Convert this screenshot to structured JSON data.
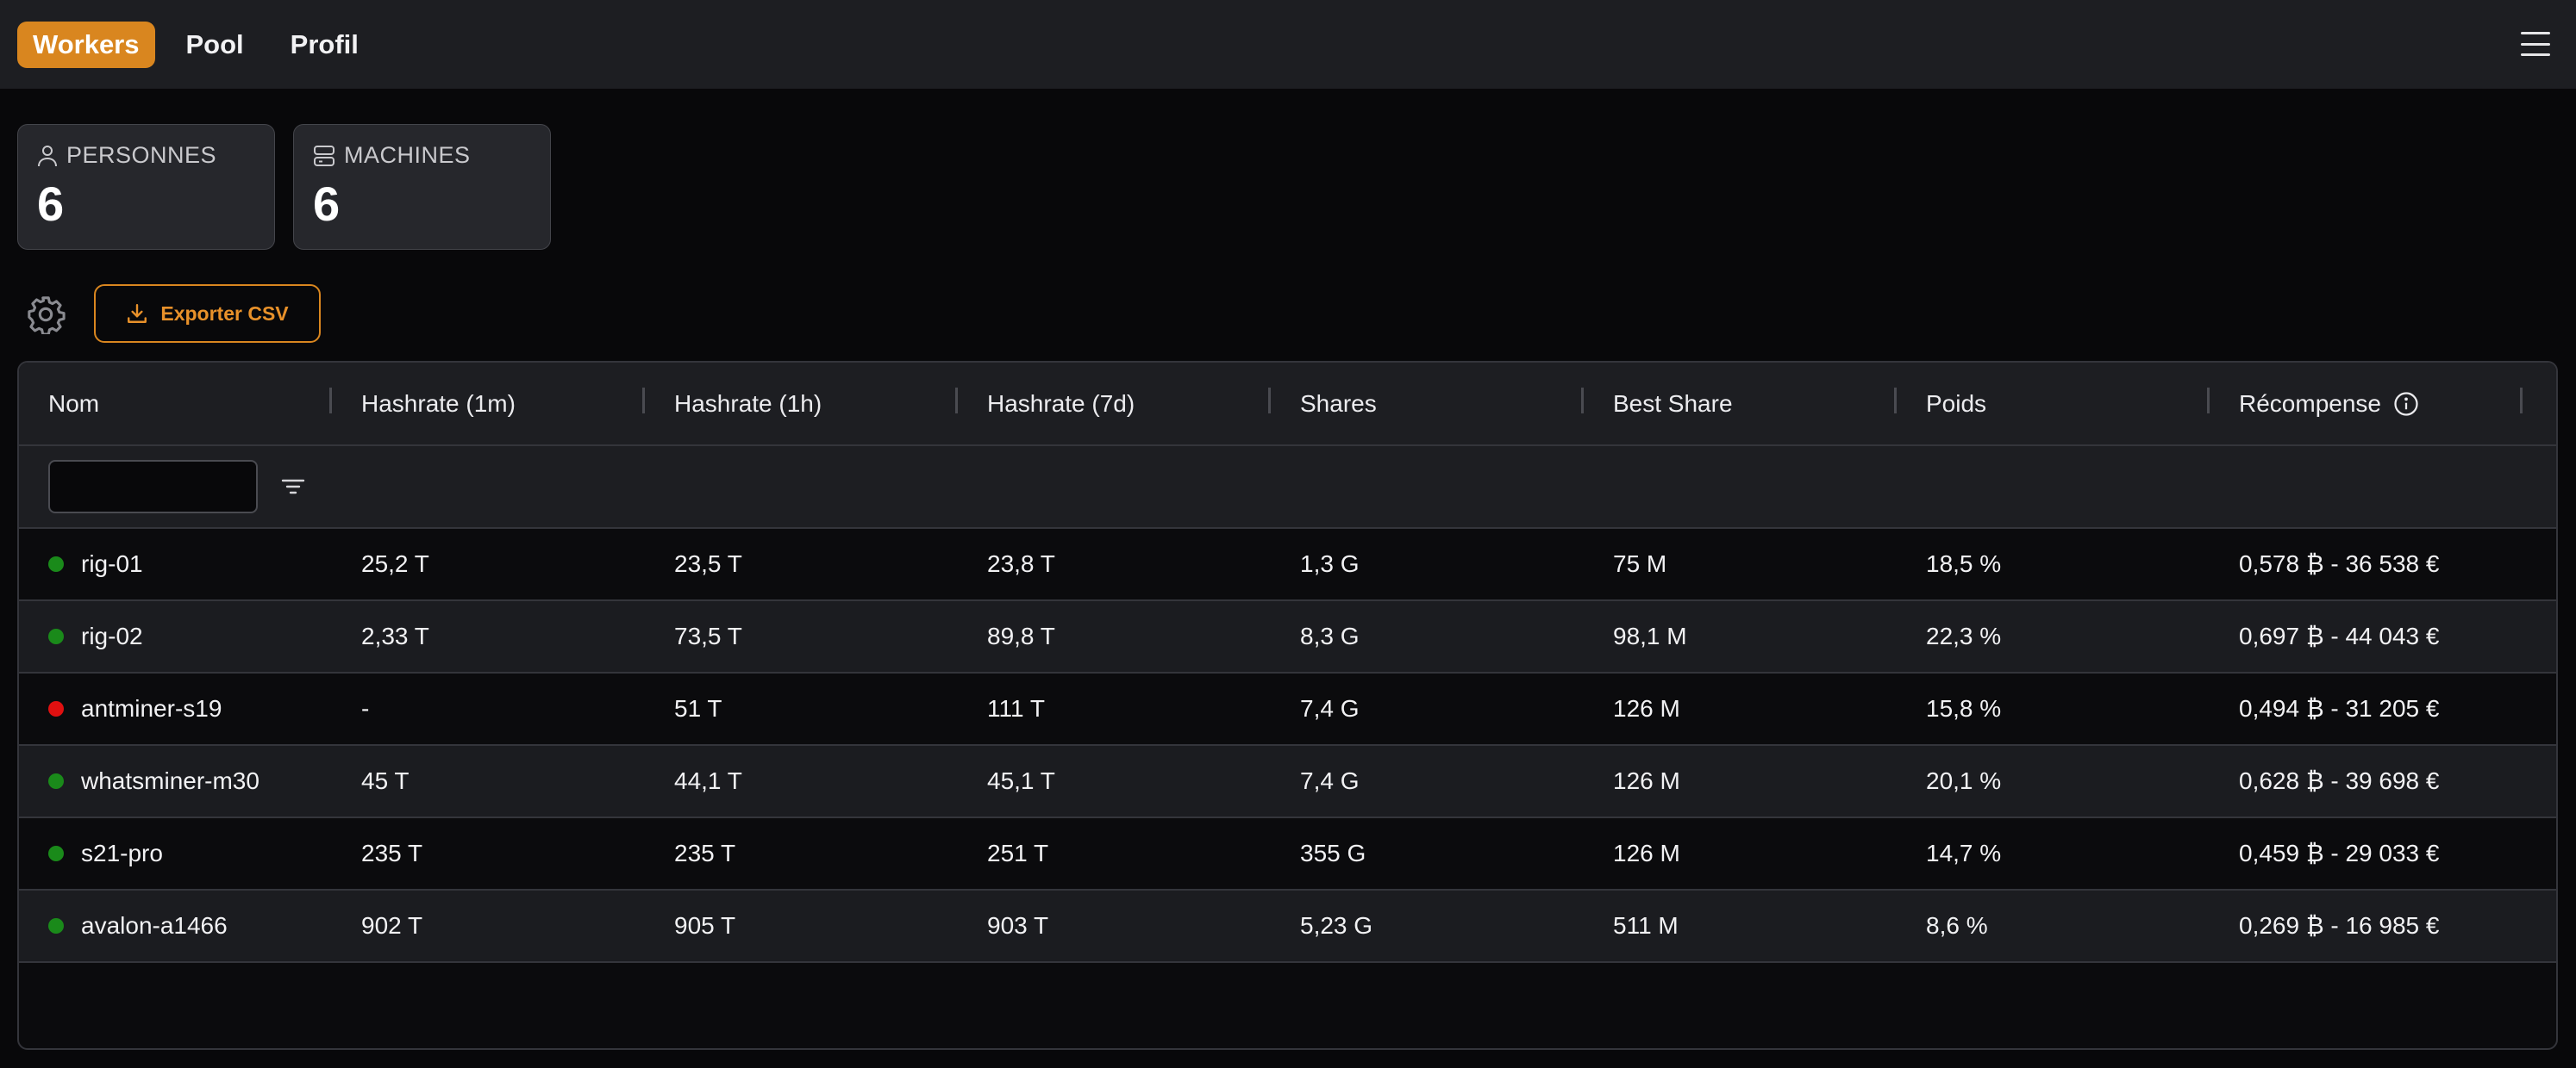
{
  "nav": {
    "items": [
      {
        "label": "Workers",
        "active": true
      },
      {
        "label": "Pool",
        "active": false
      },
      {
        "label": "Profil",
        "active": false
      }
    ]
  },
  "stats": {
    "persons": {
      "label": "PERSONNES",
      "value": "6",
      "icon": "user-icon"
    },
    "machines": {
      "label": "MACHINES",
      "value": "6",
      "icon": "server-icon"
    }
  },
  "toolbar": {
    "export_label": "Exporter CSV",
    "settings_icon": "gear-icon"
  },
  "table": {
    "columns": [
      "Nom",
      "Hashrate (1m)",
      "Hashrate (1h)",
      "Hashrate (7d)",
      "Shares",
      "Best Share",
      "Poids",
      "Récompense"
    ],
    "filter": {
      "value": "",
      "placeholder": ""
    },
    "rows": [
      {
        "status": "online",
        "cells": [
          "rig-01",
          "25,2 T",
          "23,5 T",
          "23,8 T",
          "1,3 G",
          "75 M",
          "18,5 %",
          "0,578 ₿ - 36 538 €"
        ]
      },
      {
        "status": "online",
        "cells": [
          "rig-02",
          "2,33 T",
          "73,5 T",
          "89,8 T",
          "8,3 G",
          "98,1 M",
          "22,3 %",
          "0,697 ₿ - 44 043 €"
        ]
      },
      {
        "status": "offline",
        "cells": [
          "antminer-s19",
          "-",
          "51 T",
          "111 T",
          "7,4 G",
          "126 M",
          "15,8 %",
          "0,494 ₿ - 31 205 €"
        ]
      },
      {
        "status": "online",
        "cells": [
          "whatsminer-m30",
          "45 T",
          "44,1 T",
          "45,1 T",
          "7,4 G",
          "126 M",
          "20,1 %",
          "0,628 ₿ - 39 698 €"
        ]
      },
      {
        "status": "online",
        "cells": [
          "s21-pro",
          "235 T",
          "235 T",
          "251 T",
          "355 G",
          "126 M",
          "14,7 %",
          "0,459 ₿ - 29 033 €"
        ]
      },
      {
        "status": "online",
        "cells": [
          "avalon-a1466",
          "902 T",
          "905 T",
          "903 T",
          "5,23 G",
          "511 M",
          "8,6 %",
          "0,269 ₿ - 16 985 €"
        ]
      }
    ]
  },
  "colors": {
    "accent": "#d9861f",
    "online": "#1a8a1a",
    "offline": "#e01010"
  }
}
